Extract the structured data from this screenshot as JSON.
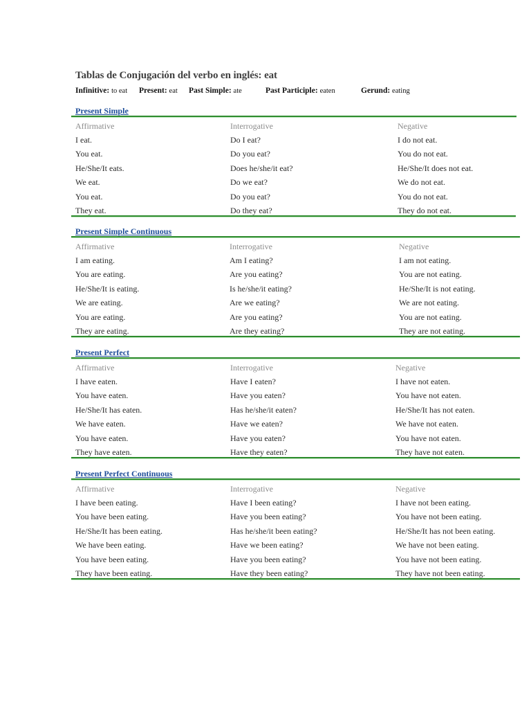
{
  "document": {
    "title": "Tablas de Conjugación del verbo en inglés: eat",
    "forms": [
      {
        "label": "Infinitive:",
        "value": "to eat"
      },
      {
        "label": "Present:",
        "value": "eat"
      },
      {
        "label": "Past Simple:",
        "value": "ate"
      },
      {
        "label": "Past Participle:",
        "value": "eaten"
      },
      {
        "label": "Gerund:",
        "value": "eating"
      }
    ],
    "columns": [
      "Affirmative",
      "Interrogative",
      "Negative"
    ],
    "sections": [
      {
        "title": "Present Simple",
        "rows": [
          [
            "I eat.",
            "Do I eat?",
            "I do not eat."
          ],
          [
            "You eat.",
            "Do you eat?",
            "You do not eat."
          ],
          [
            "He/She/It eats.",
            "Does he/she/it eat?",
            "He/She/It does not eat."
          ],
          [
            "We eat.",
            "Do we eat?",
            "We do not eat."
          ],
          [
            "You eat.",
            "Do you eat?",
            "You do not eat."
          ],
          [
            "They eat.",
            "Do they eat?",
            "They do not eat."
          ]
        ]
      },
      {
        "title": "Present Simple Continuous",
        "rows": [
          [
            "I am eating.",
            "Am I eating?",
            "I am not eating."
          ],
          [
            "You are eating.",
            "Are you eating?",
            "You are not eating."
          ],
          [
            "He/She/It is eating.",
            "Is he/she/it eating?",
            "He/She/It is not eating."
          ],
          [
            "We are eating.",
            "Are we eating?",
            "We are not eating."
          ],
          [
            "You are eating.",
            "Are you eating?",
            "You are not eating."
          ],
          [
            "They are eating.",
            "Are they eating?",
            "They are not eating."
          ]
        ]
      },
      {
        "title": "Present Perfect",
        "rows": [
          [
            "I have eaten.",
            "Have I eaten?",
            "I have not eaten."
          ],
          [
            "You have eaten.",
            "Have you eaten?",
            "You have not eaten."
          ],
          [
            "He/She/It has eaten.",
            "Has he/she/it eaten?",
            "He/She/It has not eaten."
          ],
          [
            "We have eaten.",
            "Have we eaten?",
            "We have not eaten."
          ],
          [
            "You have eaten.",
            "Have you eaten?",
            "You have not eaten."
          ],
          [
            "They have eaten.",
            "Have they eaten?",
            "They have not eaten."
          ]
        ]
      },
      {
        "title": "Present Perfect Continuous",
        "rows": [
          [
            "I have been eating.",
            "Have I been eating?",
            "I have not been eating."
          ],
          [
            "You have been eating.",
            "Have you been eating?",
            "You have not been eating."
          ],
          [
            "He/She/It has been eating.",
            "Has he/she/it been eating?",
            "He/She/It has not been eating."
          ],
          [
            "We have been eating.",
            "Have we been eating?",
            "We have not been eating."
          ],
          [
            "You have been eating.",
            "Have you been eating?",
            "You have not been eating."
          ],
          [
            "They have been eating.",
            "Have they been eating?",
            "They have not been eating."
          ]
        ]
      }
    ]
  },
  "colors": {
    "section_title": "#1f4e9a",
    "rule": "#2e8b2e",
    "column_header": "#8a8a8a",
    "title": "#404040"
  }
}
